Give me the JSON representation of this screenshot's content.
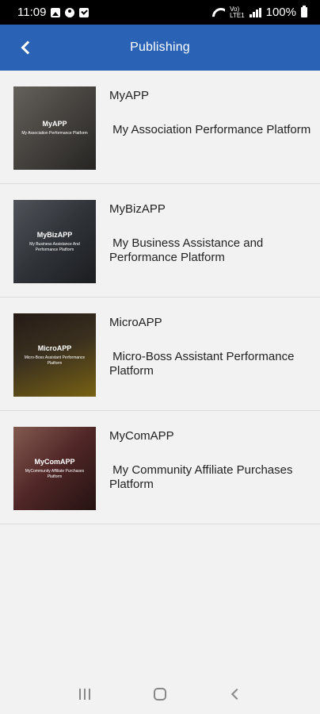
{
  "status_bar": {
    "time": "11:09",
    "network_top": "Vo)",
    "network_bottom": "LTE1",
    "battery": "100%"
  },
  "app_bar": {
    "title": "Publishing",
    "back_icon": "chevron-left-icon"
  },
  "items": [
    {
      "title": "MyAPP",
      "description": " My Association Performance Platform",
      "thumb_name": "MyAPP",
      "thumb_sub": "My Association Performance Platform",
      "thumb_color": "#6f6a64"
    },
    {
      "title": "MyBizAPP",
      "description": " My Business Assistance and Performance Platform",
      "thumb_name": "MyBizAPP",
      "thumb_sub": "My Business Assistance And Performance Platform",
      "thumb_color": "#4a4f57"
    },
    {
      "title": "MicroAPP",
      "description": " Micro-Boss Assistant Performance Platform",
      "thumb_name": "MicroAPP",
      "thumb_sub": "Micro-Boss Assistant Performance Platform",
      "thumb_color": "#7a6420"
    },
    {
      "title": "MyComAPP",
      "description": " My Community Affiliate Purchases Platform",
      "thumb_name": "MyComAPP",
      "thumb_sub": "MyCommunity Affiliate Purchases Platform",
      "thumb_color": "#7a3b3b"
    }
  ],
  "nav_bar": {
    "recents_icon": "recents-icon",
    "home_icon": "home-icon",
    "back_icon": "back-icon"
  },
  "colors": {
    "app_bar": "#2a63b6",
    "background": "#f2f2f2"
  }
}
